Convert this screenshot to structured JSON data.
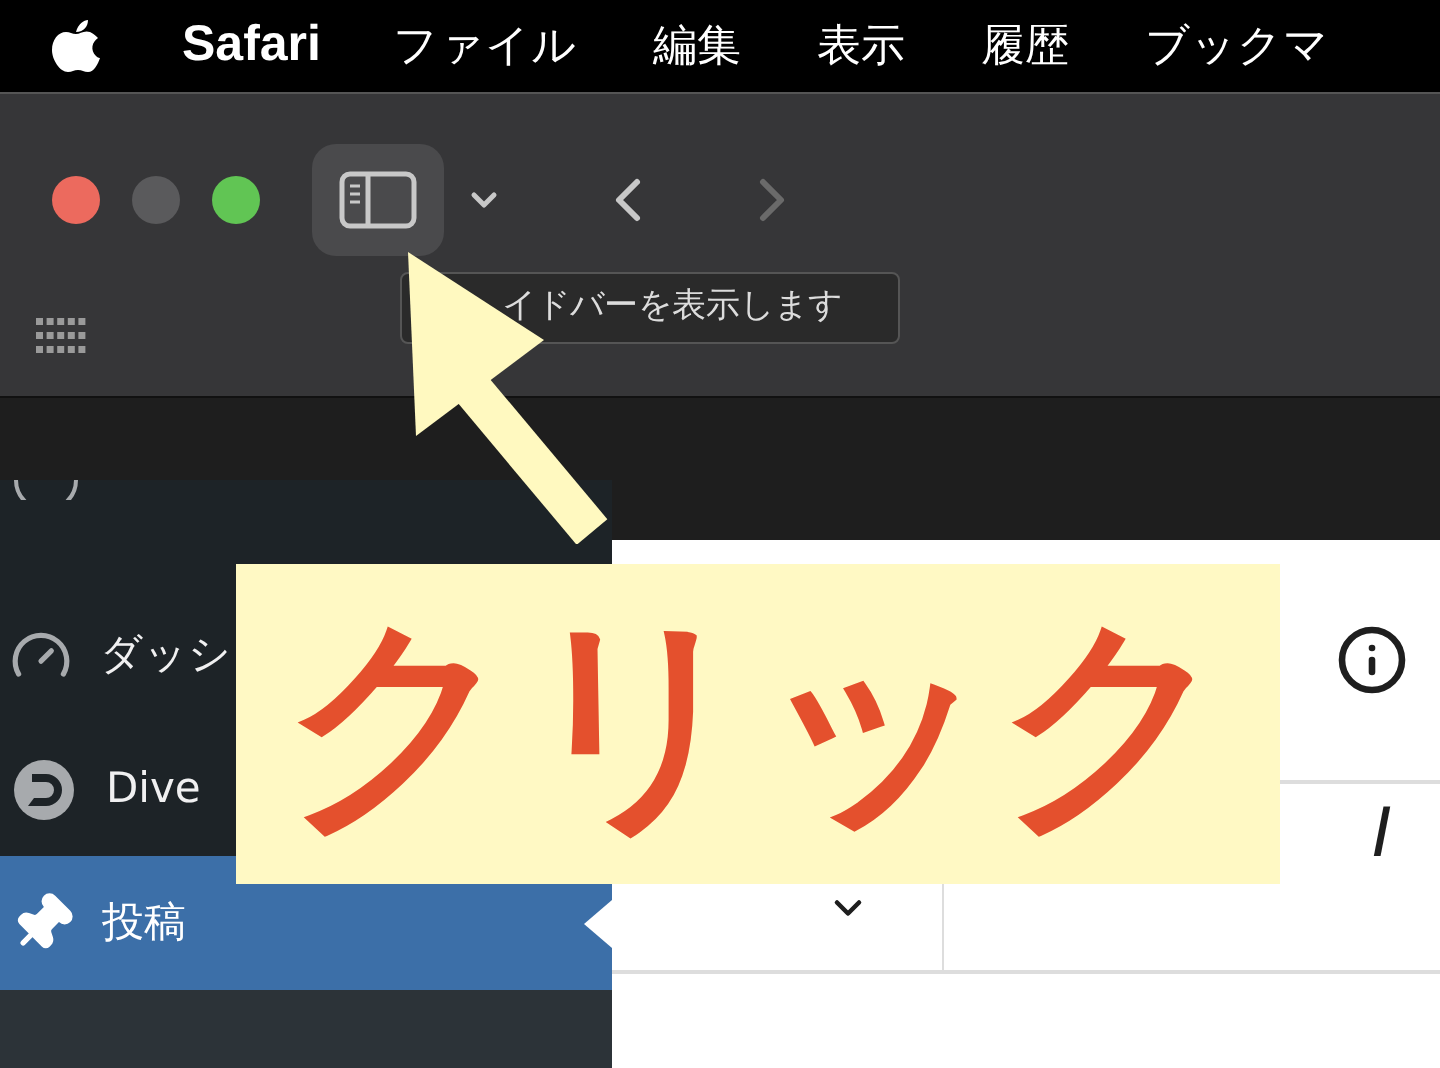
{
  "menu_bar": {
    "app_name": "Safari",
    "items": [
      "ファイル",
      "編集",
      "表示",
      "履歴",
      "ブックマ"
    ]
  },
  "toolbar": {
    "buttons": [
      {
        "kind": "sidebar",
        "selected": true
      },
      {
        "kind": "menu",
        "selected": false
      },
      {
        "kind": "back",
        "disabled": false
      },
      {
        "kind": "forward",
        "disabled": true
      }
    ]
  },
  "tooltip": "イドバーを表示します",
  "wp_sidebar": {
    "items": [
      {
        "kind": "dashboard",
        "label": "ダッシ",
        "selected": false
      },
      {
        "kind": "logo",
        "label": "Dive",
        "selected": false
      },
      {
        "kind": "pin",
        "label": "投稿",
        "selected": true
      }
    ]
  },
  "editor": {
    "toolbar_items": [
      {
        "kind": "chevron"
      },
      {
        "kind": "text",
        "label": "I"
      }
    ]
  },
  "annotation": {
    "label": "クリック"
  }
}
